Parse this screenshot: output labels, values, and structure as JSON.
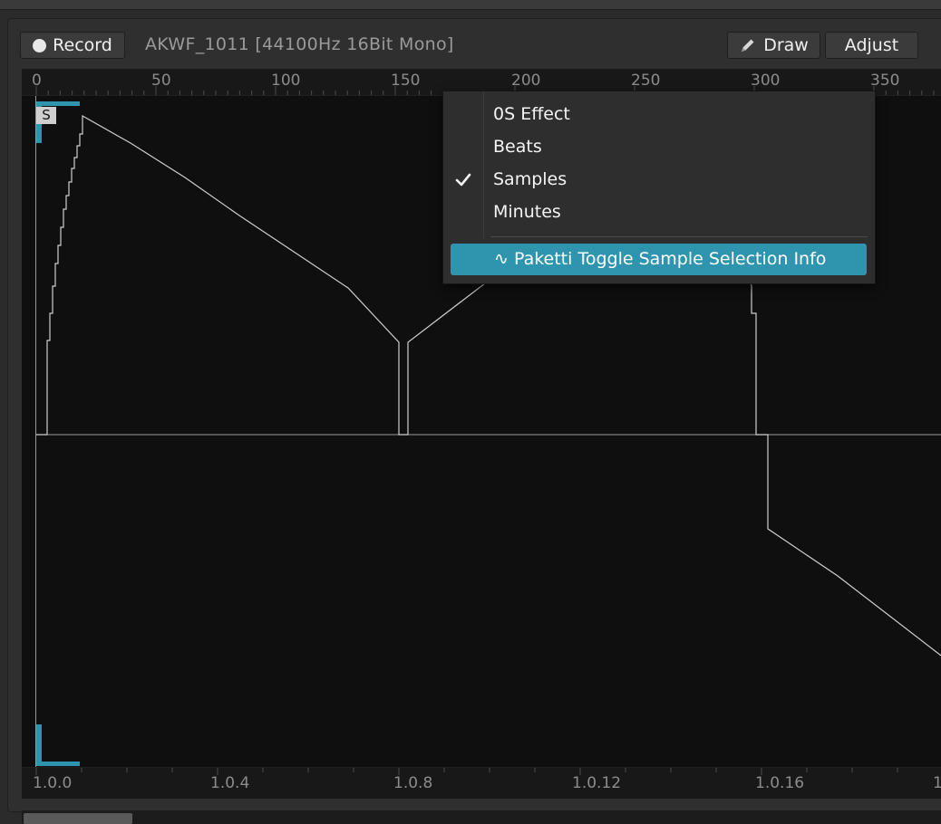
{
  "toolbar": {
    "record_label": "Record",
    "sample_title": "AKWF_1011 [44100Hz 16Bit Mono]",
    "draw_label": "Draw",
    "adjust_label": "Adjust"
  },
  "ruler_top": [
    "0",
    "50",
    "100",
    "150",
    "200",
    "250",
    "300",
    "350"
  ],
  "ruler_bottom": [
    "1.0.0",
    "1.0.4",
    "1.0.8",
    "1.0.12",
    "1.0.16",
    "1"
  ],
  "marker": {
    "start_label": "S"
  },
  "colors": {
    "accent": "#2f95ae",
    "waveform": "#cfcfcf",
    "background": "#0f0f0f"
  },
  "context_menu": {
    "items": [
      "0S Effect",
      "Beats",
      "Samples",
      "Minutes"
    ],
    "checked_item": "Samples",
    "highlighted": "∿ Paketti Toggle Sample Selection Info"
  }
}
